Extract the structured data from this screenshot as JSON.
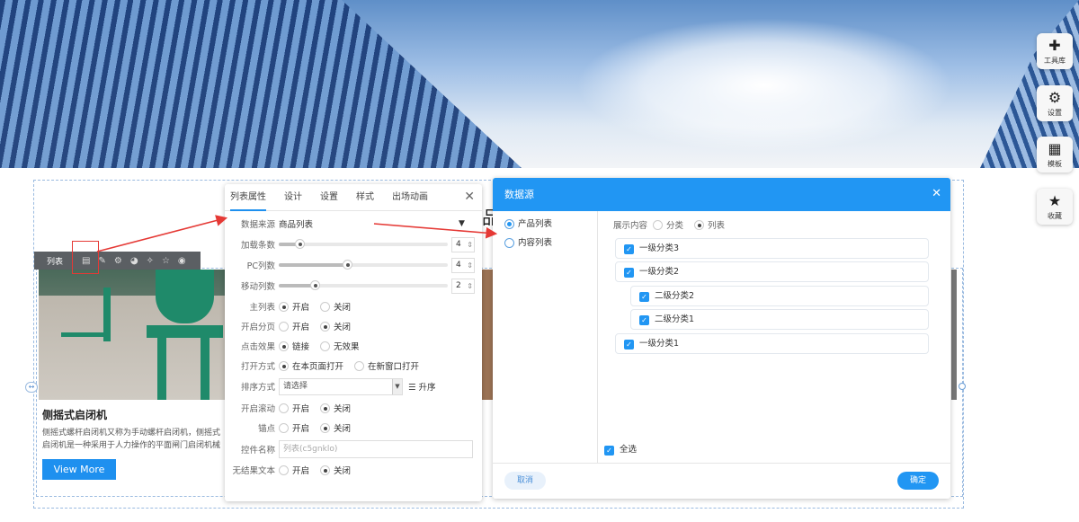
{
  "side_tools": [
    {
      "label": "工具库",
      "icon": "plus-icon"
    },
    {
      "label": "设置",
      "icon": "gears-icon"
    },
    {
      "label": "模板",
      "icon": "template-icon"
    },
    {
      "label": "收藏",
      "icon": "star-gear-icon"
    }
  ],
  "toolbar": {
    "label": "列表"
  },
  "card": {
    "title": "侧摇式启闭机",
    "desc_line1": "侧摇式螺杆启闭机又称为手动螺杆启闭机，侧摇式",
    "desc_line2": "启闭机是一种采用于人力操作的平面闸门启闭机械",
    "button": "View More"
  },
  "heading_partial": "品",
  "panel": {
    "tabs": [
      "列表属性",
      "设计",
      "设置",
      "样式",
      "出场动画"
    ],
    "data_source": {
      "label": "数据来源",
      "value": "商品列表"
    },
    "sliders": [
      {
        "label": "加载条数",
        "value": 4,
        "fraction": 0.12
      },
      {
        "label": "PC列数",
        "value": 4,
        "fraction": 0.4
      },
      {
        "label": "移动列数",
        "value": 2,
        "fraction": 0.2
      }
    ],
    "radios": [
      {
        "label": "主列表",
        "options": [
          "开启",
          "关闭"
        ],
        "selected": 0
      },
      {
        "label": "开启分页",
        "options": [
          "开启",
          "关闭"
        ],
        "selected": 1
      },
      {
        "label": "点击效果",
        "options": [
          "链接",
          "无效果"
        ],
        "selected": 0
      },
      {
        "label": "打开方式",
        "options": [
          "在本页面打开",
          "在新窗口打开"
        ],
        "selected": 0
      }
    ],
    "sort": {
      "label": "排序方式",
      "placeholder": "请选择",
      "order": "升序"
    },
    "radios2": [
      {
        "label": "开启滚动",
        "options": [
          "开启",
          "关闭"
        ],
        "selected": 1
      },
      {
        "label": "锚点",
        "options": [
          "开启",
          "关闭"
        ],
        "selected": 1
      }
    ],
    "name": {
      "label": "控件名称",
      "placeholder": "列表(c5gnklo)"
    },
    "noresult": {
      "label": "无结果文本",
      "options": [
        "开启",
        "关闭"
      ],
      "selected": 1
    }
  },
  "dialog": {
    "title": "数据源",
    "sources": [
      "产品列表",
      "内容列表"
    ],
    "display": {
      "label": "展示内容",
      "options": [
        "分类",
        "列表"
      ],
      "selected": 1
    },
    "categories": [
      {
        "name": "一级分类3",
        "level": 1
      },
      {
        "name": "一级分类2",
        "level": 1
      },
      {
        "name": "二级分类2",
        "level": 2
      },
      {
        "name": "二级分类1",
        "level": 2
      },
      {
        "name": "一级分类1",
        "level": 1
      }
    ],
    "select_all": "全选",
    "cancel": "取消",
    "ok": "确定"
  },
  "colors": {
    "accent": "#2196f3",
    "arrow": "#e53935"
  }
}
